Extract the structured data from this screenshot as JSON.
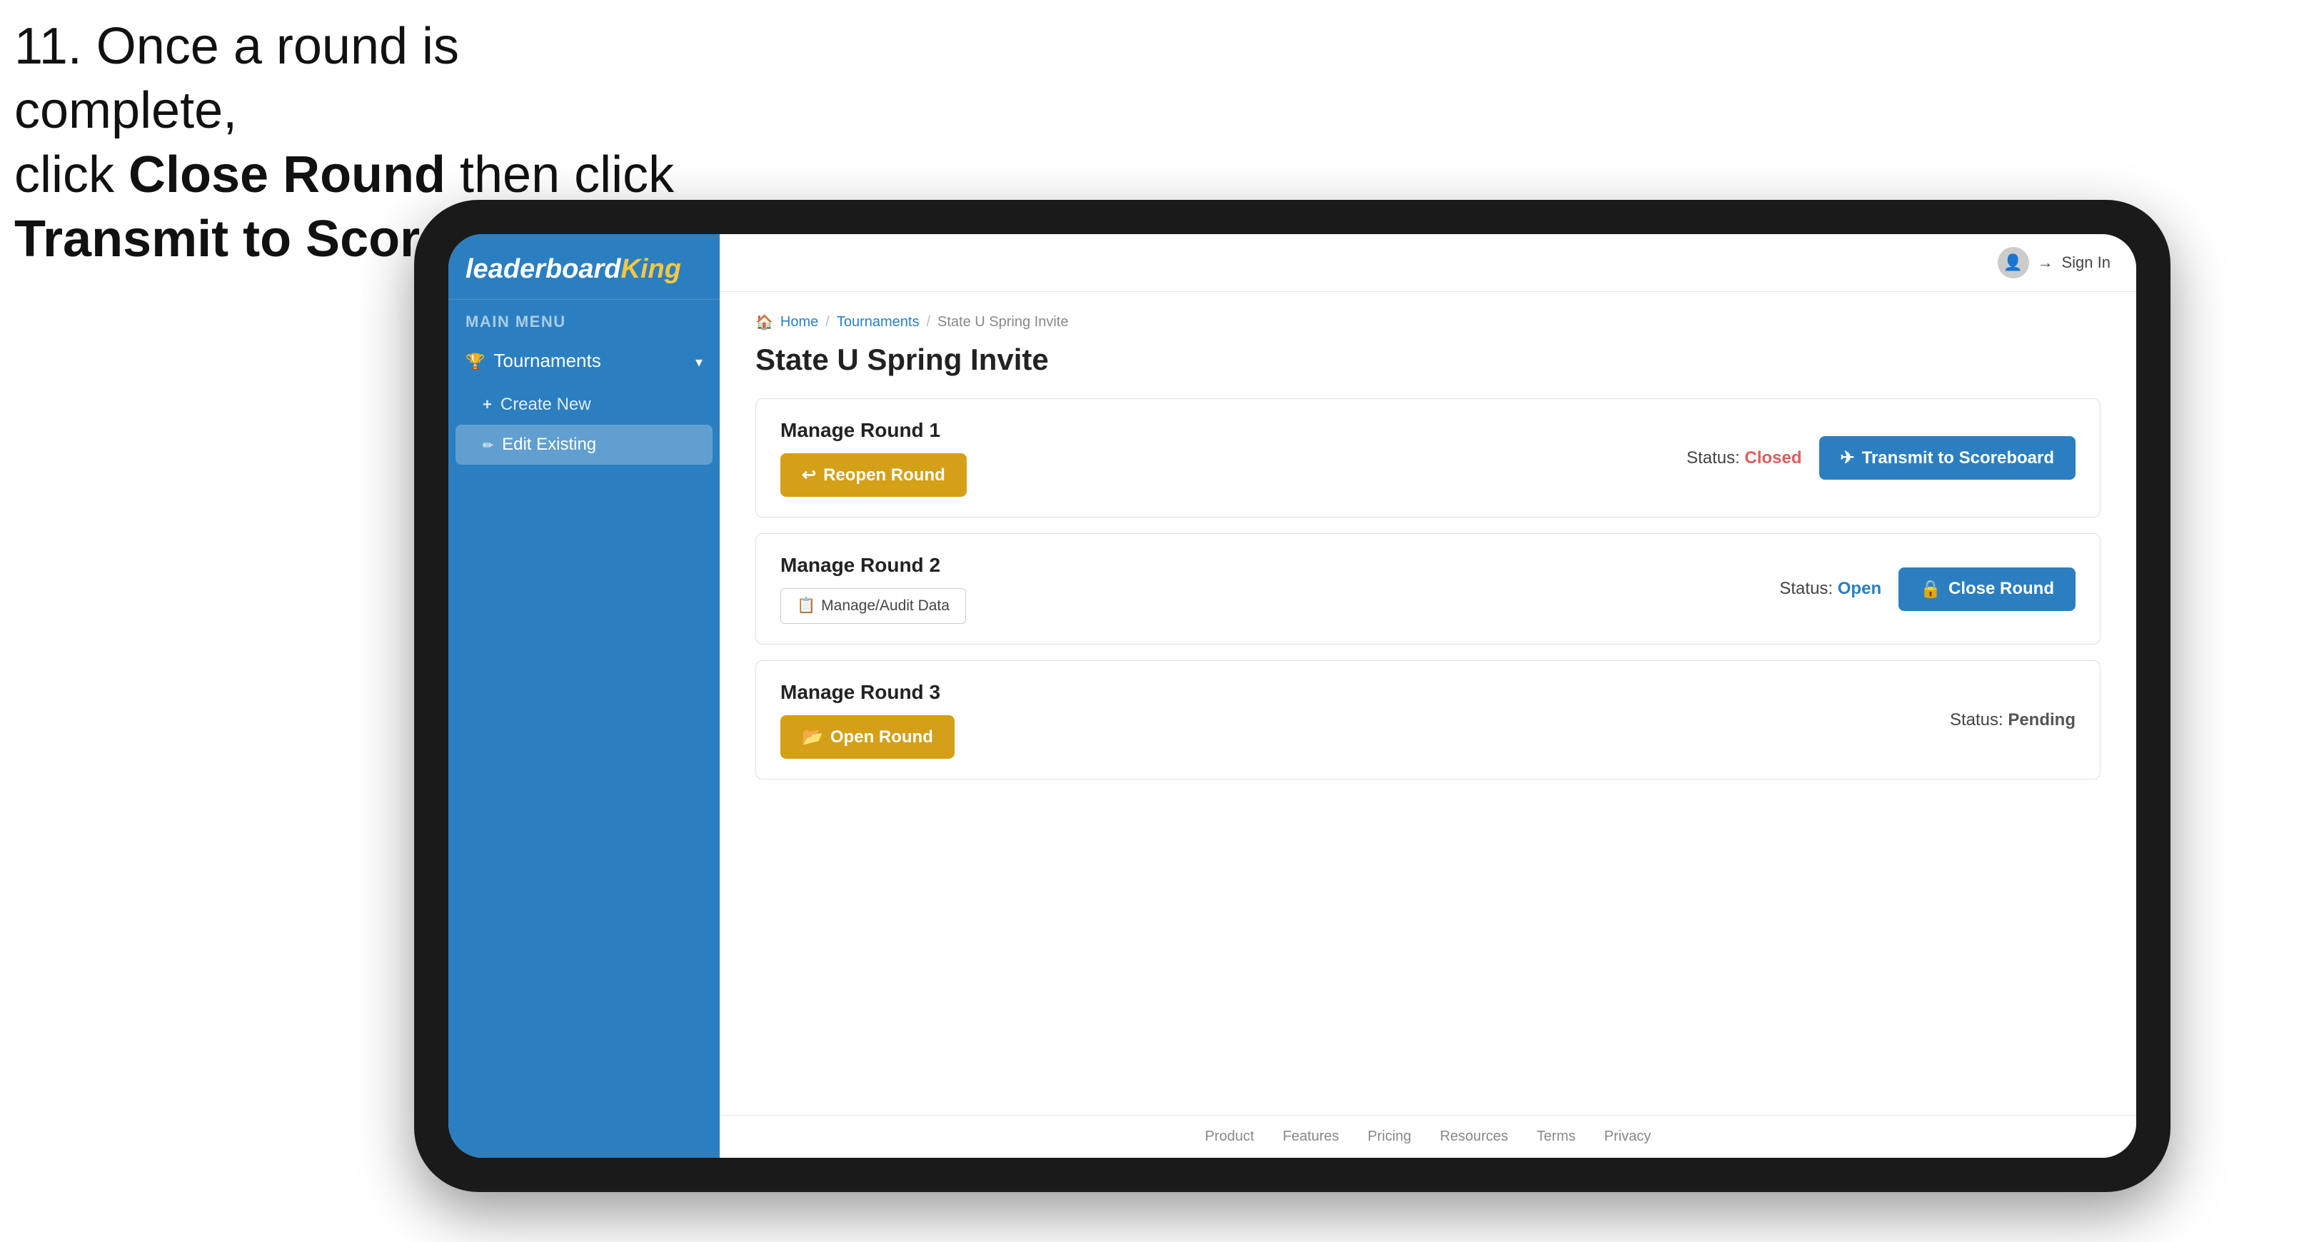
{
  "instruction": {
    "text_line1": "11. Once a round is complete,",
    "text_line2": "click ",
    "bold1": "Close Round",
    "text_line3": " then click",
    "bold2": "Transmit to Scoreboard."
  },
  "header": {
    "sign_in_label": "Sign In"
  },
  "breadcrumb": {
    "home": "Home",
    "sep1": "/",
    "tournaments": "Tournaments",
    "sep2": "/",
    "current": "State U Spring Invite"
  },
  "page_title": "State U Spring Invite",
  "sidebar": {
    "main_menu_label": "MAIN MENU",
    "logo_part1": "leaderboard",
    "logo_part2": "King",
    "tournaments_label": "Tournaments",
    "create_new_label": "Create New",
    "edit_existing_label": "Edit Existing"
  },
  "rounds": [
    {
      "id": "round1",
      "title": "Manage Round 1",
      "status_label": "Status:",
      "status_value": "Closed",
      "status_class": "status-value-closed",
      "left_button_label": "Reopen Round",
      "left_button_icon": "reopen",
      "right_button_label": "Transmit to Scoreboard",
      "right_button_icon": "send",
      "left_btn_class": "btn-gold",
      "right_btn_class": "btn-blue"
    },
    {
      "id": "round2",
      "title": "Manage Round 2",
      "status_label": "Status:",
      "status_value": "Open",
      "status_class": "status-value-open",
      "left_button_label": "Manage/Audit Data",
      "left_button_icon": "paper",
      "right_button_label": "Close Round",
      "right_button_icon": "lock",
      "left_btn_class": "btn-outline",
      "right_btn_class": "btn-blue"
    },
    {
      "id": "round3",
      "title": "Manage Round 3",
      "status_label": "Status:",
      "status_value": "Pending",
      "status_class": "status-value-pending",
      "left_button_label": "Open Round",
      "left_button_icon": "open",
      "right_button_label": null,
      "left_btn_class": "btn-gold",
      "right_btn_class": null
    }
  ],
  "footer": {
    "links": [
      "Product",
      "Features",
      "Pricing",
      "Resources",
      "Terms",
      "Privacy"
    ]
  },
  "colors": {
    "sidebar_bg": "#2b7fc1",
    "btn_gold": "#d4a017",
    "btn_blue": "#2b7fc1",
    "status_closed": "#e05c5c",
    "status_open": "#2b7fc1",
    "arrow_color": "#e8374a"
  }
}
